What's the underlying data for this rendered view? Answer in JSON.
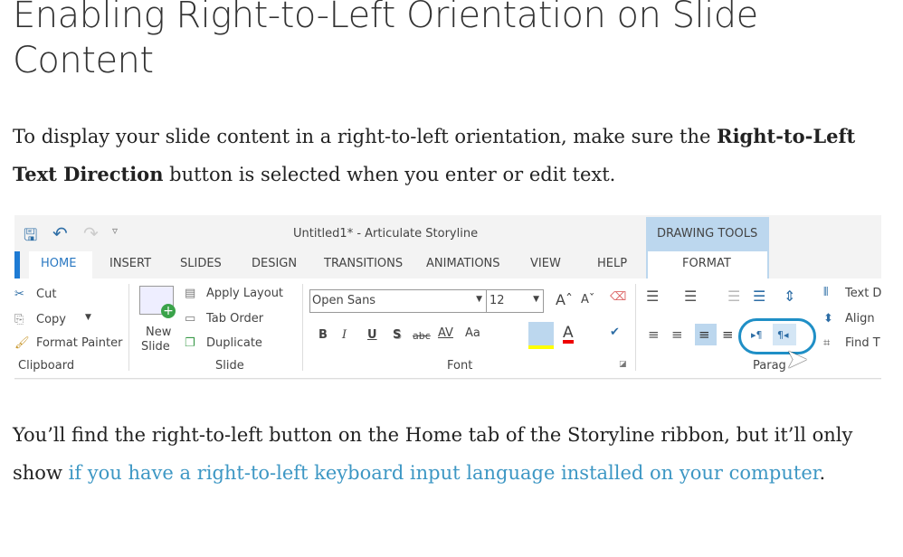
{
  "heading": "Enabling Right-to-Left Orientation on Slide Content",
  "para1": {
    "before": "To display your slide content in a right-to-left orientation, make sure the ",
    "bold": "Right-to-Left Text Direction",
    "after": " button is selected when you enter or edit text."
  },
  "ribbon": {
    "window_title": "Untitled1* -  Articulate Storyline",
    "contextual_header": "DRAWING TOOLS",
    "tabs": [
      "HOME",
      "INSERT",
      "SLIDES",
      "DESIGN",
      "TRANSITIONS",
      "ANIMATIONS",
      "VIEW",
      "HELP",
      "FORMAT"
    ],
    "clipboard": {
      "cut": "Cut",
      "copy": "Copy",
      "format_painter": "Format Painter",
      "label": "Clipboard"
    },
    "slide": {
      "new_slide_1": "New",
      "new_slide_2": "Slide",
      "apply_layout": "Apply Layout",
      "tab_order": "Tab Order",
      "duplicate": "Duplicate",
      "label": "Slide"
    },
    "font": {
      "name": "Open Sans",
      "size": "12",
      "label": "Font",
      "change_case": "Aa"
    },
    "paragraph": {
      "label": "Parag",
      "text_direction": "Text D",
      "align_text": "Align",
      "find": "Find T"
    }
  },
  "para2": {
    "before": "You’ll find the right-to-left button on the Home tab of the Storyline ribbon, but it’ll only show ",
    "link": "if you have a right-to-left keyboard input language installed on your computer",
    "after": "."
  }
}
